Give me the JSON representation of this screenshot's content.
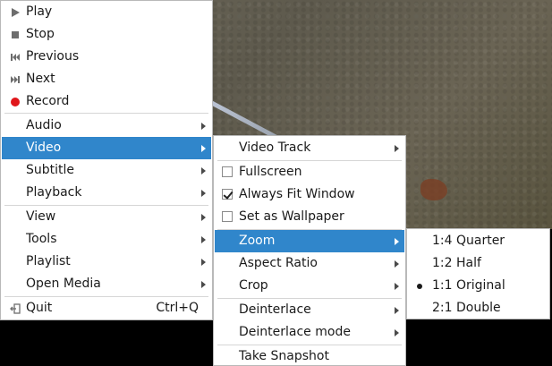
{
  "main_menu": {
    "items": [
      {
        "label": "Play",
        "icon": "play-icon"
      },
      {
        "label": "Stop",
        "icon": "stop-icon"
      },
      {
        "label": "Previous",
        "icon": "previous-icon"
      },
      {
        "label": "Next",
        "icon": "next-icon"
      },
      {
        "label": "Record",
        "icon": "record-icon"
      },
      {
        "label": "Audio",
        "submenu": true
      },
      {
        "label": "Video",
        "submenu": true,
        "highlighted": true
      },
      {
        "label": "Subtitle",
        "submenu": true
      },
      {
        "label": "Playback",
        "submenu": true
      },
      {
        "label": "View",
        "submenu": true
      },
      {
        "label": "Tools",
        "submenu": true
      },
      {
        "label": "Playlist",
        "submenu": true
      },
      {
        "label": "Open Media",
        "submenu": true
      },
      {
        "label": "Quit",
        "icon": "quit-icon",
        "shortcut": "Ctrl+Q"
      }
    ]
  },
  "video_menu": {
    "items": [
      {
        "label": "Video Track",
        "submenu": true
      },
      {
        "label": "Fullscreen",
        "checkbox": true,
        "checked": false
      },
      {
        "label": "Always Fit Window",
        "checkbox": true,
        "checked": true
      },
      {
        "label": "Set as Wallpaper",
        "checkbox": true,
        "checked": false
      },
      {
        "label": "Zoom",
        "submenu": true,
        "highlighted": true
      },
      {
        "label": "Aspect Ratio",
        "submenu": true
      },
      {
        "label": "Crop",
        "submenu": true
      },
      {
        "label": "Deinterlace",
        "submenu": true
      },
      {
        "label": "Deinterlace mode",
        "submenu": true
      },
      {
        "label": "Take Snapshot"
      }
    ]
  },
  "zoom_menu": {
    "items": [
      {
        "label": "1:4 Quarter",
        "selected": false
      },
      {
        "label": "1:2 Half",
        "selected": false
      },
      {
        "label": "1:1 Original",
        "selected": true
      },
      {
        "label": "2:1 Double",
        "selected": false
      }
    ]
  },
  "colors": {
    "highlight": "#3086cb",
    "record": "#e0161b",
    "menu_background": "#ffffff"
  }
}
